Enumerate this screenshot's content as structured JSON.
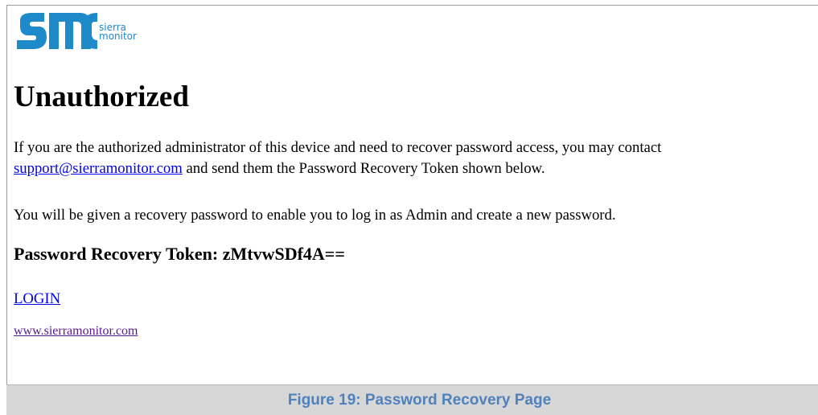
{
  "logo": {
    "text_line1": "sierra",
    "text_line2": "monitor",
    "icon": "smc-logo",
    "color": "#1f8ac9"
  },
  "page": {
    "title": "Unauthorized",
    "paragraph1_text": "If you are the authorized administrator of this device and need to recover password access, you may contact",
    "support_email": "support@sierramonitor.com",
    "paragraph1_tail": " and send them the Password Recovery Token shown below.",
    "paragraph2": "You will be given a recovery password to enable you to log in as Admin and create a new password.",
    "token_heading": "Password Recovery Token: zMtvwSDf4A==",
    "login_label": "LOGIN",
    "website_label": "www.sierramonitor.com"
  },
  "caption": {
    "text": "Figure 19: Password Recovery Page",
    "color": "#4f81bd",
    "background": "#d7d7d7"
  },
  "colors": {
    "link": "#0000ee",
    "visited_link": "#551a8b"
  }
}
